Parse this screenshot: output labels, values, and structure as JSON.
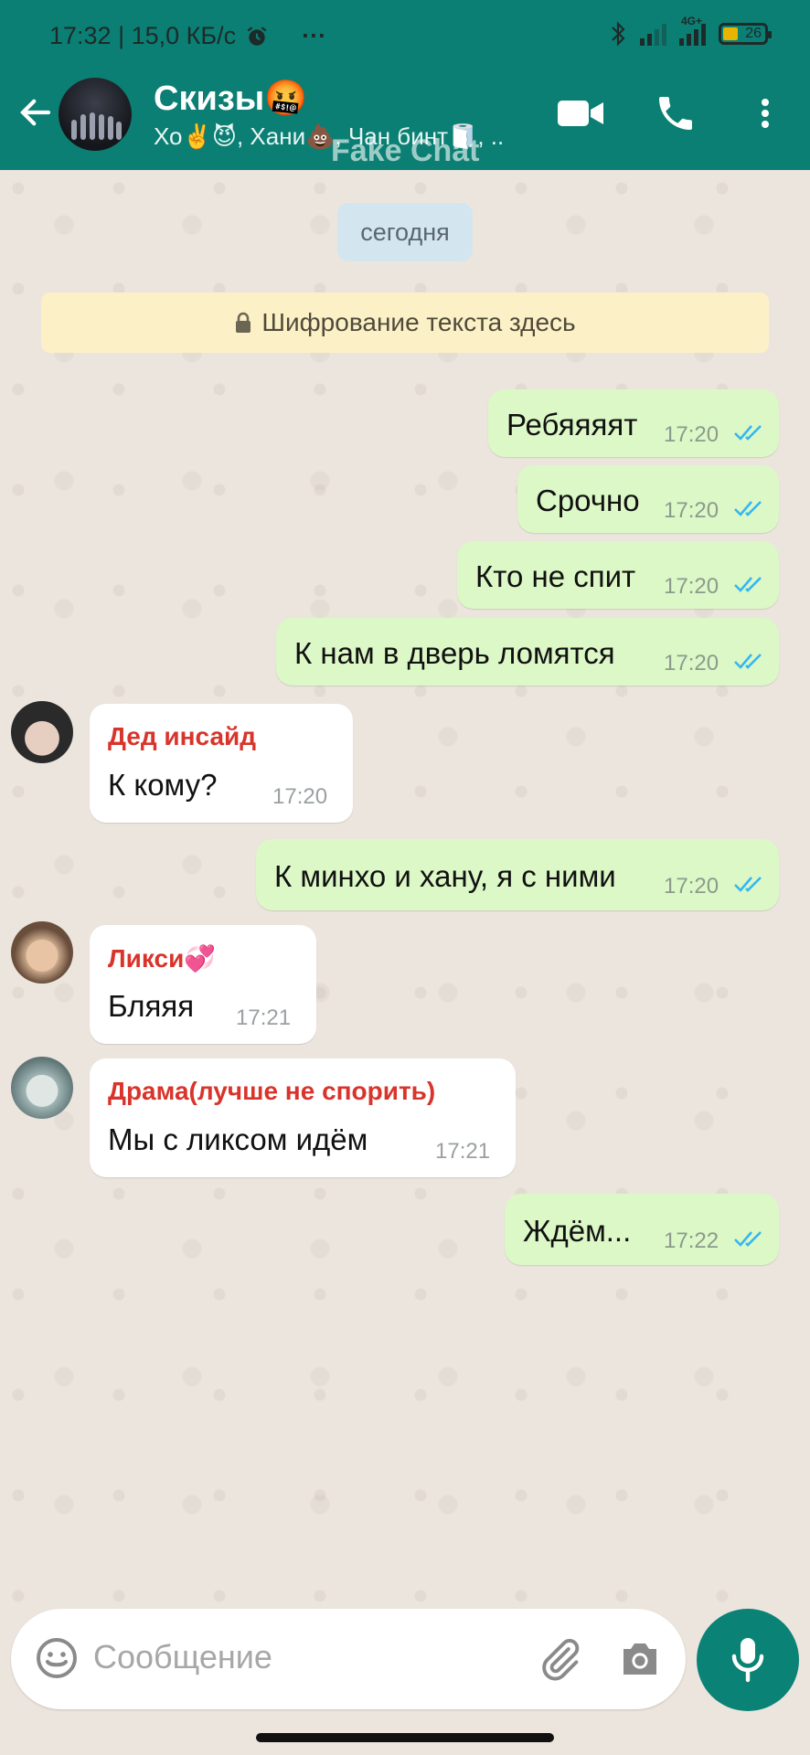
{
  "status_bar": {
    "time_speed": "17:32 | 15,0 КБ/с",
    "dots": "···",
    "network": "4G+",
    "battery": "26"
  },
  "header": {
    "title": "Скизы🤬",
    "subtitle": "Хо✌️😈, Хани💩, Чан бинт🧻, ..",
    "watermark": "Fake Chat"
  },
  "chat": {
    "date_chip": "сегодня",
    "encryption": "Шифрование текста здесь",
    "messages": [
      {
        "dir": "out",
        "text": "Ребяяяят",
        "time": "17:20"
      },
      {
        "dir": "out",
        "text": "Срочно",
        "time": "17:20"
      },
      {
        "dir": "out",
        "text": "Кто не спит",
        "time": "17:20"
      },
      {
        "dir": "out",
        "text": "К нам в дверь ломятся",
        "time": "17:20"
      },
      {
        "dir": "in",
        "sender": "Дед инсайд",
        "text": "К кому?",
        "time": "17:20"
      },
      {
        "dir": "out",
        "text": "К минхо и хану, я с ними",
        "time": "17:20"
      },
      {
        "dir": "in",
        "sender": "Ликси💞",
        "text": "Бляяя",
        "time": "17:21"
      },
      {
        "dir": "in",
        "sender": "Драма(лучше не спорить)",
        "text": "Мы с ликсом идём",
        "time": "17:21"
      },
      {
        "dir": "out",
        "text": "Ждём...",
        "time": "17:22"
      }
    ]
  },
  "composer": {
    "placeholder": "Сообщение"
  },
  "colors": {
    "header": "#0b7f73",
    "out_bubble": "#dcf8c6",
    "in_bubble": "#ffffff",
    "sender": "#d9342b",
    "ticks": "#34b7f1",
    "mic": "#0b8276"
  },
  "icons": [
    "back-arrow-icon",
    "video-call-icon",
    "phone-icon",
    "more-vert-icon",
    "lock-icon",
    "emoji-icon",
    "attach-icon",
    "camera-icon",
    "mic-icon",
    "double-check-icon",
    "bluetooth-icon",
    "alarm-icon"
  ]
}
